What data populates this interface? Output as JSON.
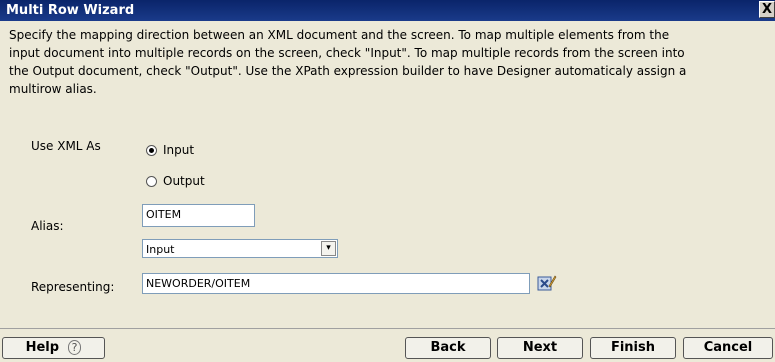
{
  "window": {
    "title": "Multi Row Wizard",
    "close_label": "X"
  },
  "description": "Specify the mapping direction between an XML document and the screen. To map multiple elements from the\ninput document into multiple records on the screen, check \"Input\". To map multiple records from the screen into\nthe Output document, check \"Output\". Use the XPath expression builder to have Designer automaticaly assign a\nmultirow alias.",
  "use_xml_as": {
    "label": "Use XML As",
    "options": [
      {
        "label": "Input",
        "checked": true
      },
      {
        "label": "Output",
        "checked": false
      }
    ]
  },
  "alias": {
    "label": "Alias:",
    "value": "OITEM",
    "select_value": "Input"
  },
  "representing": {
    "label": "Representing:",
    "value": "NEWORDER/OITEM",
    "builder_icon": "xpath-builder-icon"
  },
  "footer": {
    "help_label": "Help",
    "back_label": "Back",
    "next_label": "Next",
    "finish_label": "Finish",
    "cancel_label": "Cancel"
  }
}
